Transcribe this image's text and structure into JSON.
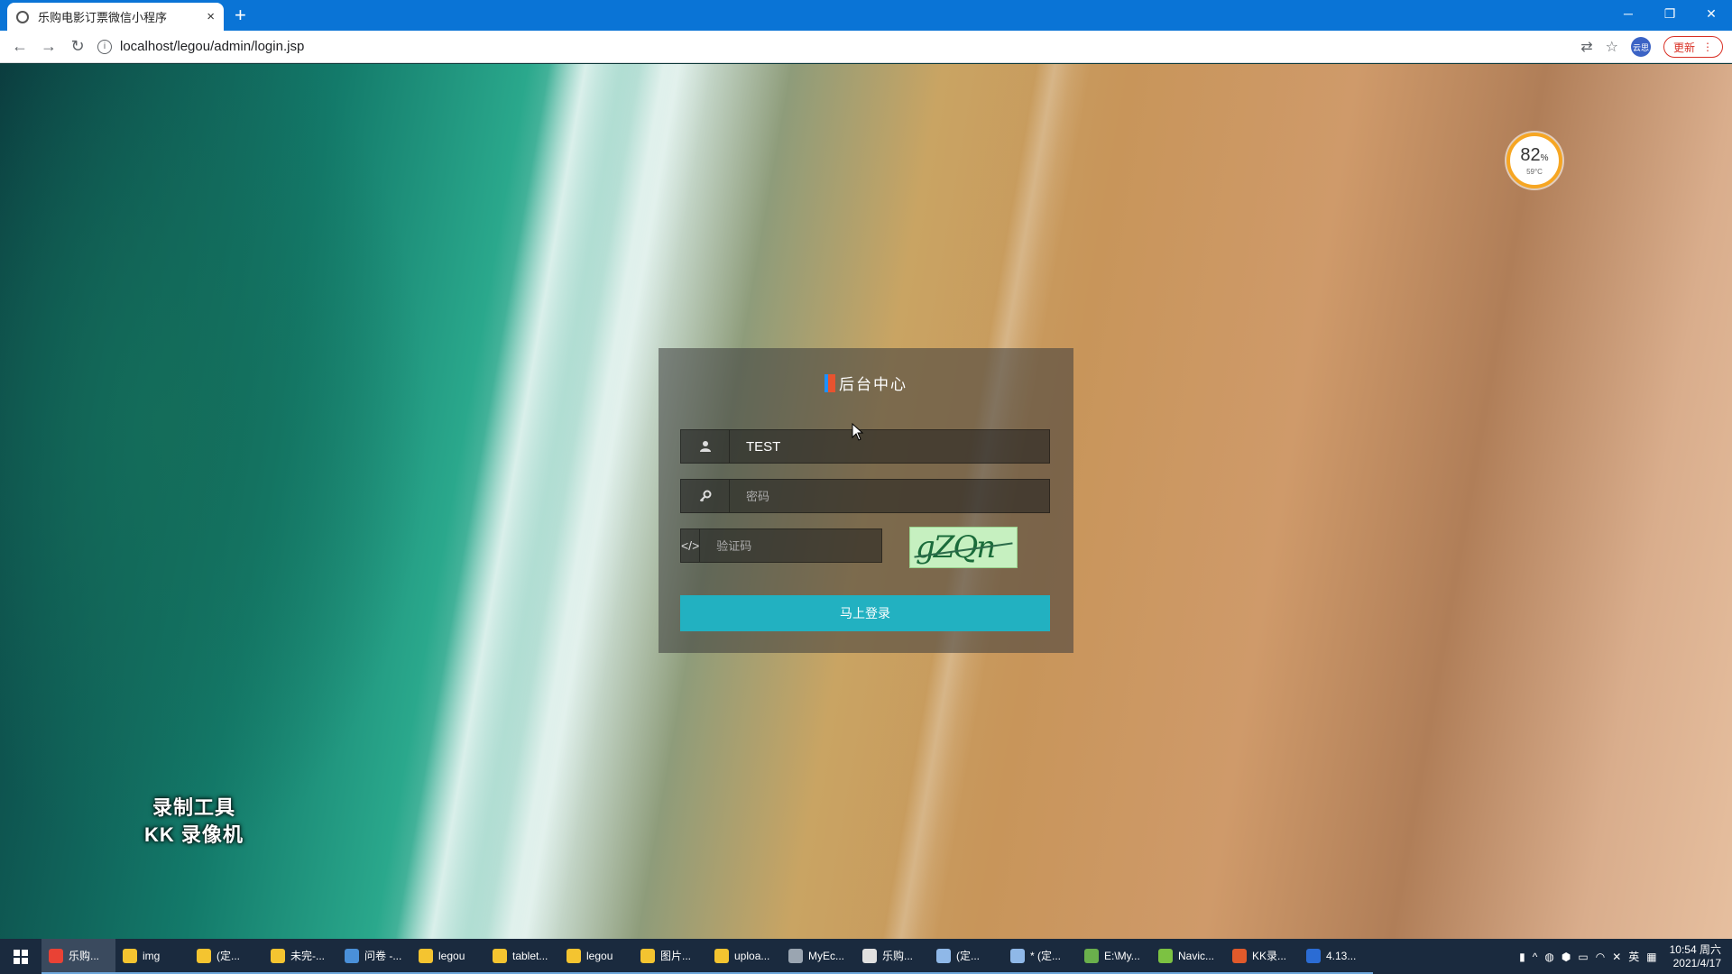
{
  "browser": {
    "tab_title": "乐购电影订票微信小程序",
    "tab_close": "×",
    "new_tab": "+",
    "url": "localhost/legou/admin/login.jsp",
    "update_label": "更新",
    "profile_label": "云思",
    "win_minimize": "─",
    "win_restore": "❐",
    "win_close": "✕"
  },
  "overlay": {
    "gauge_percent": "82",
    "gauge_unit": "%",
    "gauge_temp": "59°C",
    "watermark_line1": "录制工具",
    "watermark_line2": "KK 录像机"
  },
  "login": {
    "title": "后台中心",
    "username_value": "TEST",
    "password_placeholder": "密码",
    "captcha_placeholder": "验证码",
    "captcha_text": "gZQn",
    "submit_label": "马上登录"
  },
  "taskbar": {
    "items": [
      {
        "label": "乐购...",
        "color": "#e94235"
      },
      {
        "label": "img",
        "color": "#f4c430"
      },
      {
        "label": "(定...",
        "color": "#f4c430"
      },
      {
        "label": "未完-...",
        "color": "#f4c430"
      },
      {
        "label": "问卷 -...",
        "color": "#4a90d9"
      },
      {
        "label": "legou",
        "color": "#f4c430"
      },
      {
        "label": "tablet...",
        "color": "#f4c430"
      },
      {
        "label": "legou",
        "color": "#f4c430"
      },
      {
        "label": "图片...",
        "color": "#f4c430"
      },
      {
        "label": "uploa...",
        "color": "#f4c430"
      },
      {
        "label": "MyEc...",
        "color": "#9aa5b1"
      },
      {
        "label": "乐购...",
        "color": "#e0e0e0"
      },
      {
        "label": "(定...",
        "color": "#8fb8e8"
      },
      {
        "label": "* (定...",
        "color": "#8fb8e8"
      },
      {
        "label": "E:\\My...",
        "color": "#6ab04c"
      },
      {
        "label": "Navic...",
        "color": "#7cc242"
      },
      {
        "label": "KK录...",
        "color": "#e05a2b"
      },
      {
        "label": "4.13...",
        "color": "#2b6cd4"
      }
    ],
    "ime": "英",
    "time": "10:54 周六",
    "date": "2021/4/17"
  }
}
